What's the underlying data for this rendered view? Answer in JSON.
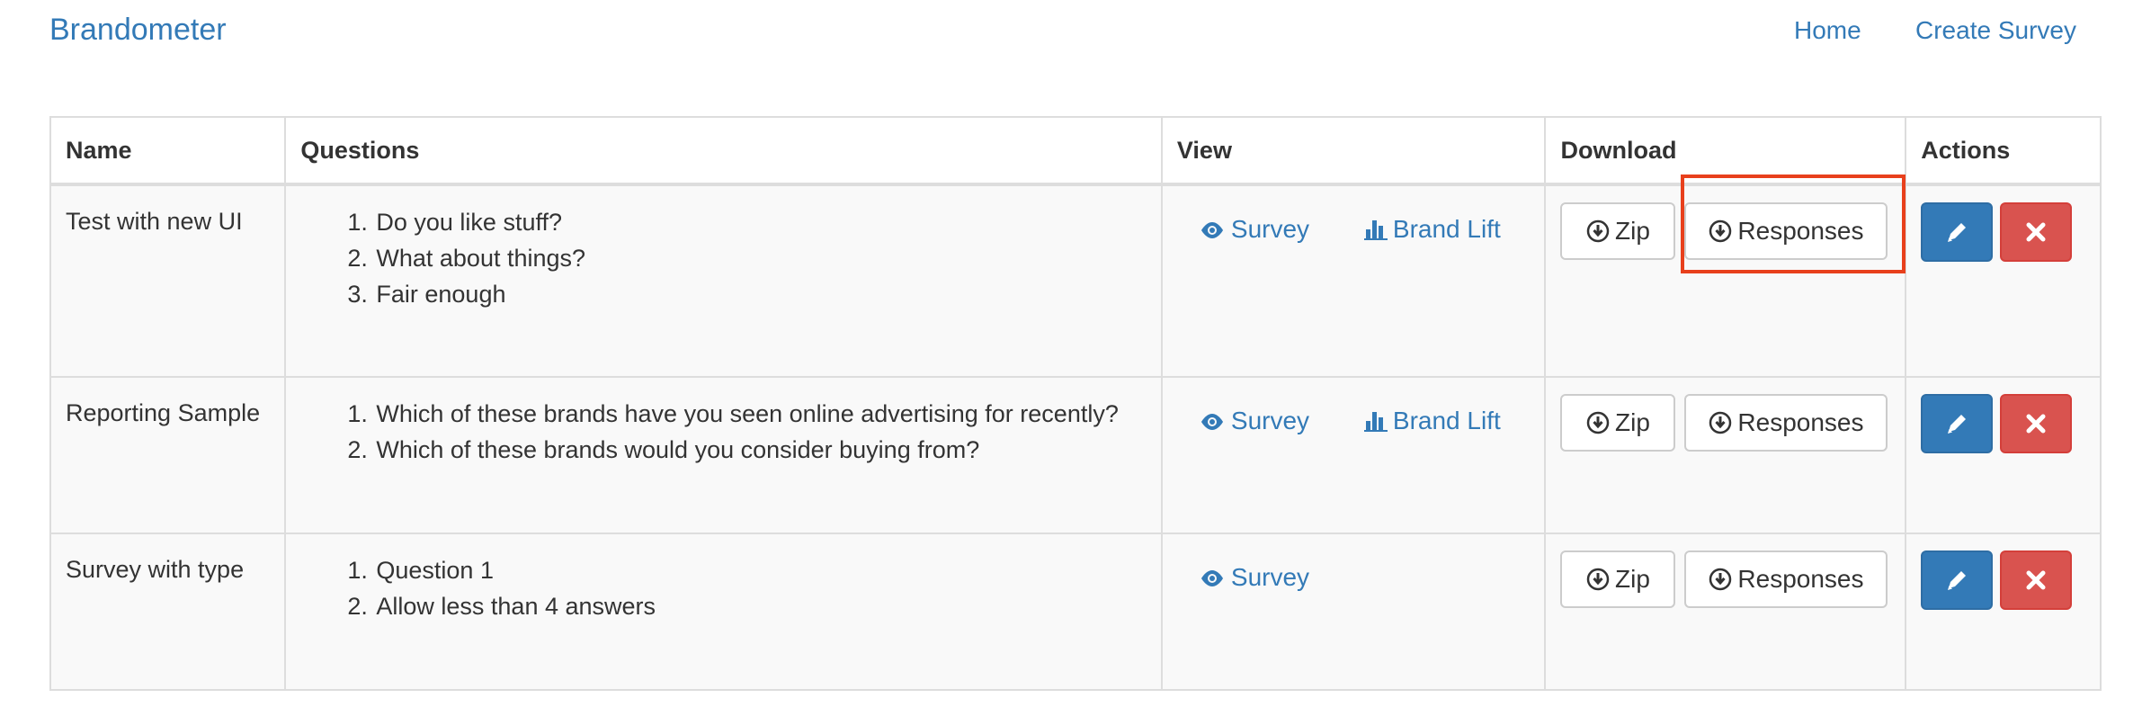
{
  "header": {
    "brand": "Brandometer",
    "nav": [
      {
        "label": "Home"
      },
      {
        "label": "Create Survey"
      }
    ]
  },
  "table": {
    "columns": [
      "Name",
      "Questions",
      "View",
      "Download",
      "Actions"
    ],
    "rows": [
      {
        "name": "Test with new UI",
        "questions": [
          "Do you like stuff?",
          "What about things?",
          "Fair enough"
        ],
        "view_survey": "Survey",
        "view_brand_lift": "Brand Lift",
        "download_zip": "Zip",
        "download_responses": "Responses"
      },
      {
        "name": "Reporting Sample",
        "questions": [
          "Which of these brands have you seen online advertising for recently?",
          "Which of these brands would you consider buying from?"
        ],
        "view_survey": "Survey",
        "view_brand_lift": "Brand Lift",
        "download_zip": "Zip",
        "download_responses": "Responses"
      },
      {
        "name": "Survey with type",
        "questions": [
          "Question 1",
          "Allow less than 4 answers"
        ],
        "view_survey": "Survey",
        "download_zip": "Zip",
        "download_responses": "Responses"
      }
    ]
  },
  "icons": {
    "view_survey": "eye-icon",
    "view_brand_lift": "bar-chart-icon",
    "download": "download-circle-icon",
    "edit": "pencil-icon",
    "delete": "x-icon"
  },
  "colors": {
    "link": "#337ab7",
    "primary": "#337ab7",
    "danger": "#d9534f",
    "highlight": "#e8401c",
    "row_bg": "#f9f9f9",
    "border": "#dddddd"
  },
  "highlighted_element": "Responses"
}
